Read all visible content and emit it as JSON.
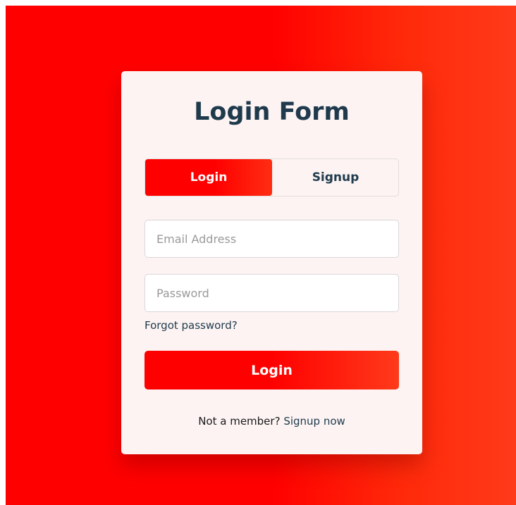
{
  "form": {
    "title": "Login Form",
    "tabs": [
      {
        "label": "Login",
        "active": true
      },
      {
        "label": "Signup",
        "active": false
      }
    ],
    "email": {
      "placeholder": "Email Address",
      "value": ""
    },
    "password": {
      "placeholder": "Password",
      "value": ""
    },
    "forgot_label": "Forgot password?",
    "submit_label": "Login",
    "footer": {
      "prompt": "Not a member?",
      "link_label": "Signup now"
    }
  },
  "colors": {
    "accent": "#ff0000",
    "accent_end": "#ff3a1a",
    "card_bg": "#fcf3f2",
    "heading": "#1f3a4d"
  }
}
